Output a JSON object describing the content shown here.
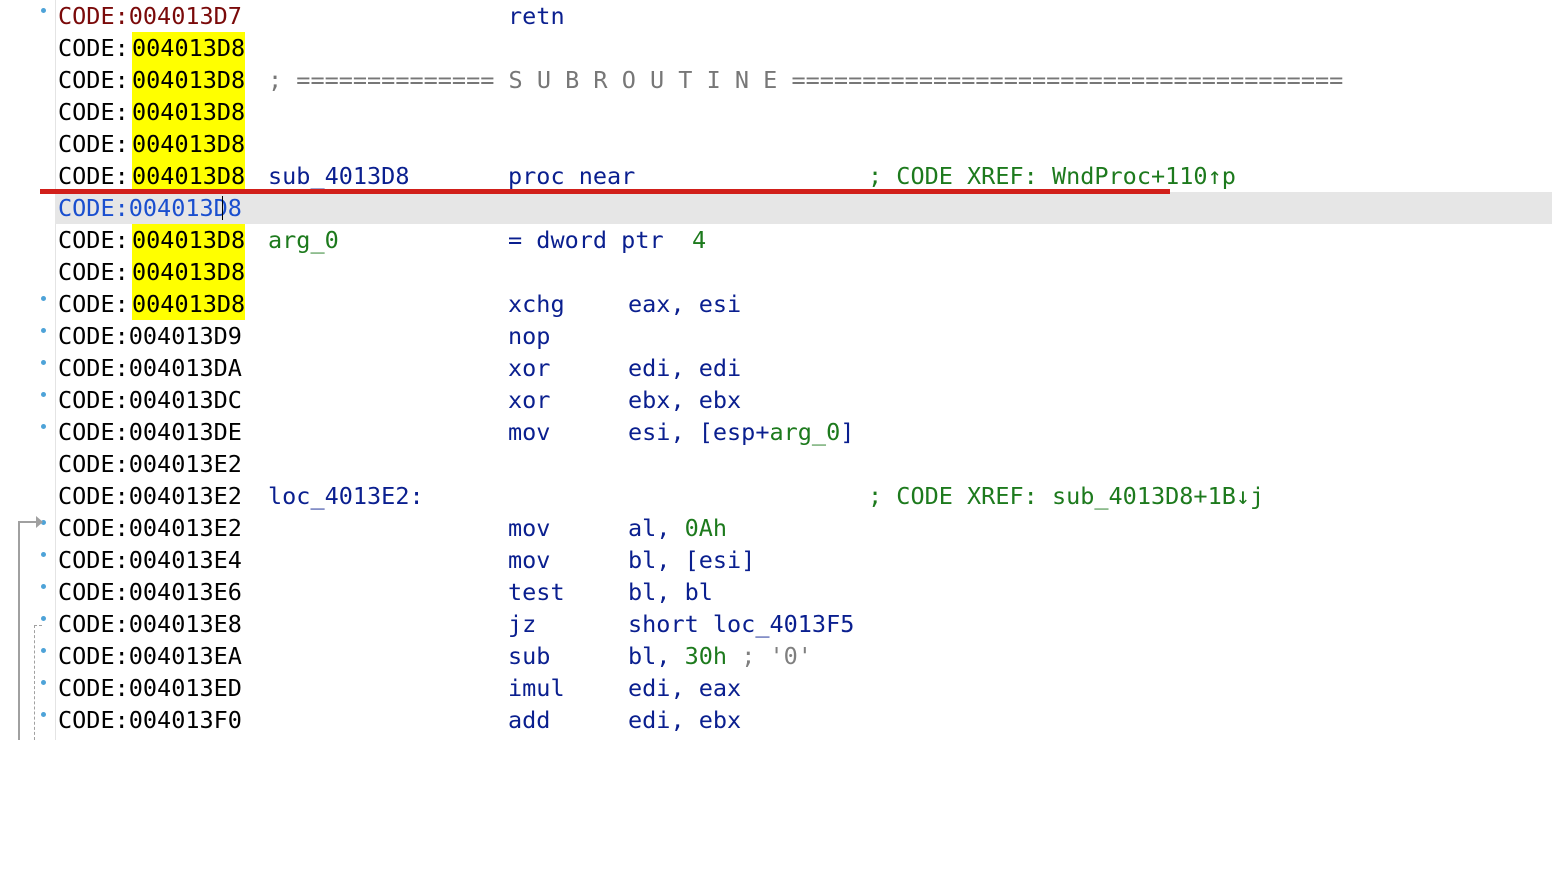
{
  "colors": {
    "background": "#ffffff",
    "address_highlight": "#ffff00",
    "current_line": "#e6e6e6",
    "segment_current": "#1a4fcf",
    "mnemonic": "#0a1f8f",
    "comment": "#1d7a1d",
    "separator": "#777777",
    "breakpoint_bar": "#d11f1a",
    "exec_dot": "#4ea3d8"
  },
  "rows": [
    {
      "seg": "CODE:",
      "addr": "004013D7",
      "mnem": "retn"
    },
    {
      "seg": "CODE:",
      "addr": "004013D8"
    },
    {
      "seg": "CODE:",
      "addr": "004013D8",
      "sep": "; ============== S U B R O U T I N E ======================================="
    },
    {
      "seg": "CODE:",
      "addr": "004013D8"
    },
    {
      "seg": "CODE:",
      "addr": "004013D8"
    },
    {
      "seg": "CODE:",
      "addr": "004013D8",
      "label": "sub_4013D8",
      "mnem": "proc near",
      "cmt_prefix": "; CODE XREF: ",
      "cmt_target": "WndProc+110↑p"
    },
    {
      "seg": "CODE:",
      "addr": "004013D8"
    },
    {
      "seg": "CODE:",
      "addr": "004013D8",
      "label": "arg_0",
      "mnem": "= dword ptr",
      "mnem_val": "4"
    },
    {
      "seg": "CODE:",
      "addr": "004013D8"
    },
    {
      "seg": "CODE:",
      "addr": "004013D8",
      "mnem": "xchg",
      "ops": "eax, esi"
    },
    {
      "seg": "CODE:",
      "addr": "004013D9",
      "mnem": "nop"
    },
    {
      "seg": "CODE:",
      "addr": "004013DA",
      "mnem": "xor",
      "ops": "edi, edi"
    },
    {
      "seg": "CODE:",
      "addr": "004013DC",
      "mnem": "xor",
      "ops": "ebx, ebx"
    },
    {
      "seg": "CODE:",
      "addr": "004013DE",
      "mnem": "mov",
      "ops_pre": "esi, [esp+",
      "ops_var": "arg_0",
      "ops_post": "]"
    },
    {
      "seg": "CODE:",
      "addr": "004013E2"
    },
    {
      "seg": "CODE:",
      "addr": "004013E2",
      "label": "loc_4013E2:",
      "cmt_prefix": "; CODE XREF: ",
      "cmt_target": "sub_4013D8+1B↓j"
    },
    {
      "seg": "CODE:",
      "addr": "004013E2",
      "mnem": "mov",
      "ops_pre": "al, ",
      "ops_num": "0Ah"
    },
    {
      "seg": "CODE:",
      "addr": "004013E4",
      "mnem": "mov",
      "ops": "bl, [esi]"
    },
    {
      "seg": "CODE:",
      "addr": "004013E6",
      "mnem": "test",
      "ops": "bl, bl"
    },
    {
      "seg": "CODE:",
      "addr": "004013E8",
      "mnem": "jz",
      "ops": "short loc_4013F5"
    },
    {
      "seg": "CODE:",
      "addr": "004013EA",
      "mnem": "sub",
      "ops_pre": "bl, ",
      "ops_num": "30h",
      "ops_cmt": " ; '0'"
    },
    {
      "seg": "CODE:",
      "addr": "004013ED",
      "mnem": "imul",
      "ops": "edi, eax"
    },
    {
      "seg": "CODE:",
      "addr": "004013F0",
      "mnem": "add",
      "ops": "edi, ebx"
    }
  ]
}
